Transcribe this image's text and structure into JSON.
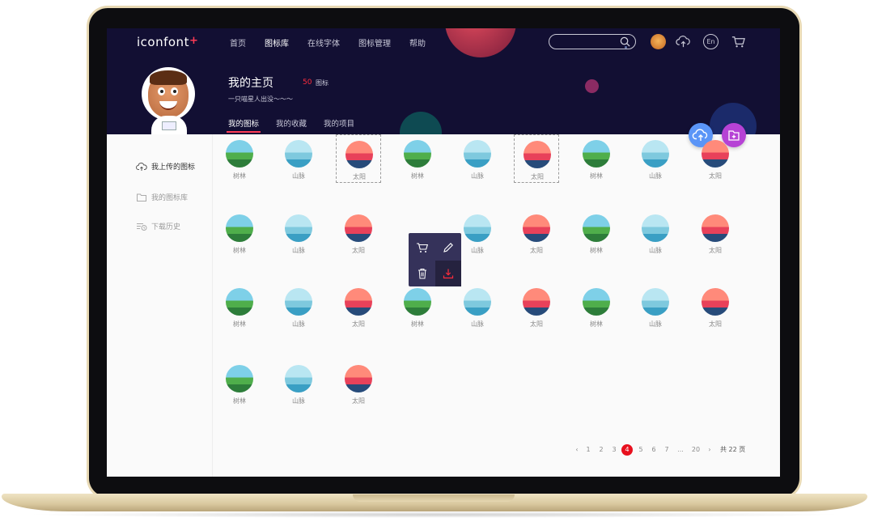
{
  "header": {
    "logo_text": "iconfont",
    "logo_plus": "+",
    "nav": [
      "首页",
      "图标库",
      "在线字体",
      "图标管理",
      "帮助"
    ],
    "active_nav_index": 1,
    "lang_label": "En"
  },
  "profile": {
    "title": "我的主页",
    "icon_count": "50",
    "icon_count_unit": "图标",
    "subtitle": "一只喵星人出没～～～",
    "tabs": [
      "我的图标",
      "我的收藏",
      "我的项目"
    ]
  },
  "sidebar": {
    "items": [
      "我上传的图标",
      "我的图标库",
      "下载历史"
    ]
  },
  "icons": {
    "rows": [
      [
        "树林",
        "山脉",
        "太阳",
        "树林",
        "山脉",
        "太阳",
        "树林",
        "山脉",
        "太阳"
      ],
      [
        "树林",
        "山脉",
        "太阳",
        "",
        "山脉",
        "太阳",
        "树林",
        "山脉",
        "太阳"
      ],
      [
        "树林",
        "山脉",
        "太阳",
        "树林",
        "山脉",
        "太阳",
        "树林",
        "山脉",
        "太阳"
      ],
      [
        "树林",
        "山脉",
        "太阳"
      ]
    ]
  },
  "pagination": {
    "prev": "‹",
    "pages": [
      "1",
      "2",
      "3",
      "4",
      "5",
      "6",
      "7",
      "...",
      "20"
    ],
    "current": "4",
    "next": "›",
    "total": "共 22 页"
  },
  "colors": {
    "accent_red": "#e8101e",
    "hero_bg": "#120f33",
    "fab_upload": "#5b95f7",
    "fab_folder": "#b642d5"
  }
}
